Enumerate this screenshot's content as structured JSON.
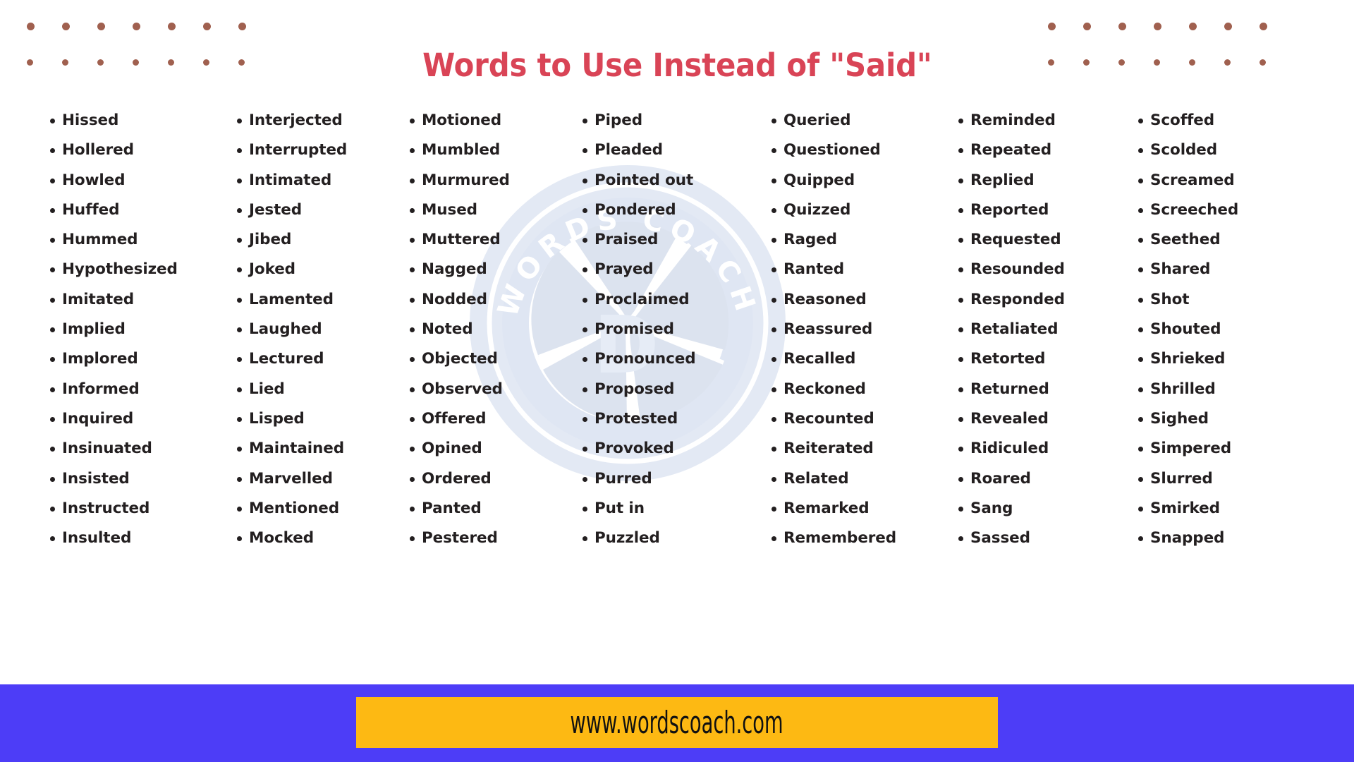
{
  "header": {
    "title": "Words to Use Instead of \"Said\"",
    "title_color": "#d94456",
    "dot_color": "#a0604f",
    "dots_per_row": 7,
    "dot_rows": 2
  },
  "watermark": {
    "text_top": "WORDS COACH",
    "letter": "D",
    "color": "#dce3ef"
  },
  "main": {
    "word_text_color": "#231f20",
    "columns": [
      {
        "index": 1,
        "words": [
          "Hissed",
          "Hollered",
          "Howled",
          "Huffed",
          "Hummed",
          "Hypothesized",
          "Imitated",
          "Implied",
          "Implored",
          "Informed",
          "Inquired",
          "Insinuated",
          "Insisted",
          "Instructed",
          "Insulted"
        ]
      },
      {
        "index": 2,
        "words": [
          "Interjected",
          "Interrupted",
          "Intimated",
          "Jested",
          "Jibed",
          "Joked",
          "Lamented",
          "Laughed",
          "Lectured",
          "Lied",
          "Lisped",
          "Maintained",
          "Marvelled",
          "Mentioned",
          "Mocked"
        ]
      },
      {
        "index": 3,
        "words": [
          "Motioned",
          "Mumbled",
          "Murmured",
          "Mused",
          "Muttered",
          "Nagged",
          "Nodded",
          "Noted",
          "Objected",
          "Observed",
          "Offered",
          "Opined",
          "Ordered",
          "Panted",
          "Pestered"
        ]
      },
      {
        "index": 4,
        "words": [
          "Piped",
          "Pleaded",
          "Pointed out",
          "Pondered",
          "Praised",
          "Prayed",
          "Proclaimed",
          "Promised",
          "Pronounced",
          "Proposed",
          "Protested",
          "Provoked",
          "Purred",
          "Put in",
          "Puzzled"
        ]
      },
      {
        "index": 5,
        "words": [
          "Queried",
          "Questioned",
          "Quipped",
          "Quizzed",
          "Raged",
          "Ranted",
          "Reasoned",
          "Reassured",
          "Recalled",
          "Reckoned",
          "Recounted",
          "Reiterated",
          "Related",
          "Remarked",
          "Remembered"
        ]
      },
      {
        "index": 6,
        "words": [
          "Reminded",
          "Repeated",
          "Replied",
          "Reported",
          "Requested",
          "Resounded",
          "Responded",
          "Retaliated",
          "Retorted",
          "Returned",
          "Revealed",
          "Ridiculed",
          "Roared",
          "Sang",
          "Sassed"
        ]
      },
      {
        "index": 7,
        "words": [
          "Scoffed",
          "Scolded",
          "Screamed",
          "Screeched",
          "Seethed",
          "Shared",
          "Shot",
          "Shouted",
          "Shrieked",
          "Shrilled",
          "Sighed",
          "Simpered",
          "Slurred",
          "Smirked",
          "Snapped"
        ]
      }
    ]
  },
  "footer": {
    "url": "www.wordscoach.com",
    "bar_color": "#4d3df7",
    "box_color": "#fdb913",
    "url_color": "#111111"
  }
}
